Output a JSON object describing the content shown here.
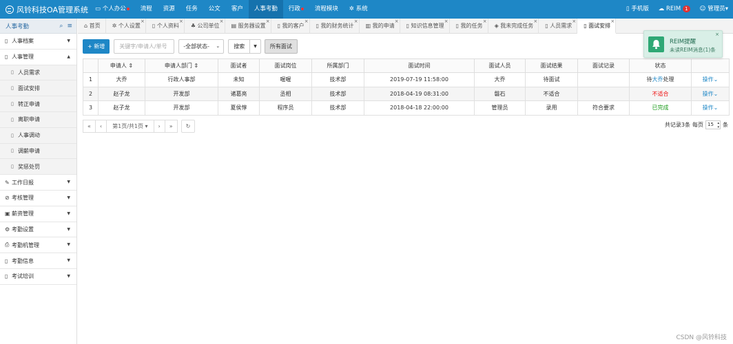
{
  "app": {
    "title": "风铃科技OA管理系统"
  },
  "topnav": [
    {
      "label": "个人办公",
      "icon": "monitor-icon",
      "dot": true
    },
    {
      "label": "流程"
    },
    {
      "label": "资源"
    },
    {
      "label": "任务"
    },
    {
      "label": "公文"
    },
    {
      "label": "客户"
    },
    {
      "label": "人事考勤",
      "active": true
    },
    {
      "label": "行政",
      "dot": true
    },
    {
      "label": "流程模块"
    },
    {
      "label": "系统",
      "icon": "gear-icon"
    }
  ],
  "topright": {
    "mobile": "手机版",
    "reim": "REIM",
    "reim_count": "1",
    "user": "管理员"
  },
  "sidebar": {
    "title": "人事考勤",
    "items": [
      {
        "label": "人事档案",
        "caret": "▼"
      },
      {
        "label": "人事管理",
        "caret": "▲"
      },
      {
        "label": "工作日报",
        "caret": "▼"
      },
      {
        "label": "考核管理",
        "caret": "▼"
      },
      {
        "label": "薪资管理",
        "caret": "▼"
      },
      {
        "label": "考勤设置",
        "caret": "▼"
      },
      {
        "label": "考勤机管理",
        "caret": "▼"
      },
      {
        "label": "考勤信息",
        "caret": "▼"
      },
      {
        "label": "考试培训",
        "caret": "▼"
      }
    ],
    "subitems": [
      "人员需求",
      "面试安排",
      "转正申请",
      "离职申请",
      "人事调动",
      "调薪申请",
      "奖惩处罚"
    ]
  },
  "tabs": [
    "首页",
    "个人设置",
    "个人资料",
    "公司单位",
    "服务器设置",
    "我的客户",
    "我的财务统计",
    "我的申请",
    "知识信息管理",
    "我的任务",
    "我未完成任务",
    "人员需求",
    "面试安排"
  ],
  "toolbar": {
    "add": "新增",
    "search_placeholder": "关键字/申请人/单号",
    "status_select": "-全部状态-",
    "search": "搜索",
    "all": "所有面试"
  },
  "table": {
    "headers": [
      "",
      "申请人",
      "申请人部门",
      "面试者",
      "面试岗位",
      "所属部门",
      "面试时间",
      "面试人员",
      "面试结果",
      "面试记录",
      "状态",
      ""
    ],
    "rows": [
      {
        "idx": "1",
        "applicant": "大乔",
        "dept": "行政人事部",
        "interviewee": "未知",
        "position": "喔喔",
        "belong": "技术部",
        "time": "2019-07-19 11:58:00",
        "interviewer": "大乔",
        "result": "待面试",
        "record": "",
        "status_pre": "待",
        "status_hl": "大乔",
        "status_post": "处理",
        "action": "操作"
      },
      {
        "idx": "2",
        "applicant": "赵子龙",
        "dept": "开发部",
        "interviewee": "诸葛亮",
        "position": "丞相",
        "belong": "技术部",
        "time": "2018-04-19 08:31:00",
        "interviewer": "磐石",
        "result": "不适合",
        "record": "",
        "status": "不适合",
        "action": "操作"
      },
      {
        "idx": "3",
        "applicant": "赵子龙",
        "dept": "开发部",
        "interviewee": "夏侯惇",
        "position": "程序员",
        "belong": "技术部",
        "time": "2018-04-18 22:00:00",
        "interviewer": "管理员",
        "result": "录用",
        "record": "符合要求",
        "status": "已完成",
        "action": "操作"
      }
    ]
  },
  "pager": {
    "first": "«",
    "prev": "‹",
    "page": "第1页/共1页",
    "next": "›",
    "last": "»",
    "summary": "共记录3条",
    "per_page_label": "每页",
    "per_page": "15",
    "unit": "条"
  },
  "toast": {
    "title": "REIM提醒",
    "message": "未读REIM消息(1)条"
  },
  "watermark": "CSDN @风铃科技",
  "colors": {
    "primary": "#1e87c6",
    "danger": "#e11111",
    "success": "#1a9a1a"
  }
}
